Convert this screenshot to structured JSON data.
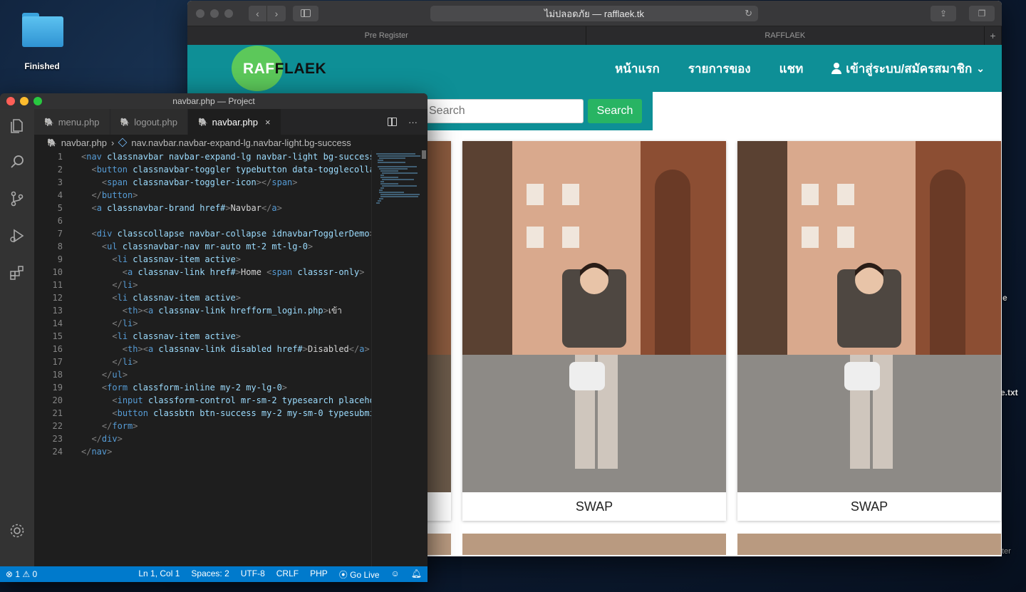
{
  "desktop": {
    "folder_label": "Finished",
    "peek_1": "e",
    "peek_2": "e.txt",
    "peek_3": "ter"
  },
  "browser": {
    "url": "ไม่ปลอดภัย — rafflaek.tk",
    "tabs": [
      "Pre Register",
      "RAFFLAEK"
    ],
    "add_tab": "+"
  },
  "site": {
    "logo_a": "RAF",
    "logo_b": "FLAEK",
    "nav": {
      "home": "หน้าแรก",
      "items": "รายการของ",
      "chat": "แชท",
      "login": "เข้าสู่ระบบ/สมัครสมาชิก"
    },
    "search": {
      "placeholder": "Search",
      "button": "Search"
    },
    "cards": [
      {
        "caption": "SWAP"
      },
      {
        "caption": "SWAP"
      }
    ]
  },
  "vscode": {
    "title": "navbar.php — Project",
    "tabs": [
      "menu.php",
      "logout.php",
      "navbar.php"
    ],
    "breadcrumb": {
      "file": "navbar.php",
      "symbol": "nav.navbar.navbar-expand-lg.navbar-light.bg-success"
    },
    "code_lines": [
      "<nav class=\"navbar navbar-expand-lg navbar-light bg-success\">",
      "  <button class=\"navbar-toggler\" type=\"button\" data-toggle=\"collapse\">",
      "    <span class=\"navbar-toggler-icon\"></span>",
      "  </button>",
      "  <a class=\"navbar-brand\" href=\"#\">Navbar</a>",
      "",
      "  <div class=\"collapse navbar-collapse\" id=\"navbarTogglerDemo\">",
      "    <ul class=\"navbar-nav mr-auto mt-2 mt-lg-0\">",
      "      <li class=\"nav-item active\">",
      "        <a class=\"nav-link\" href=\"#\">Home <span class=\"sr-only\">",
      "      </li>",
      "      <li class=\"nav-item active\">",
      "        <th><a class=\"nav-link\" href=\"form_login.php\">เข้า",
      "      </li>",
      "      <li class=\"nav-item active\">",
      "        <th><a class=\"nav-link disabled\" href=\"#\">Disabled</a>",
      "      </li>",
      "    </ul>",
      "    <form class=\"form-inline my-2 my-lg-0\">",
      "      <input class=\"form-control mr-sm-2\" type=\"search\" placeholder",
      "      <button class=\"btn btn-success my-2 my-sm-0\" type=\"submit\">",
      "    </form>",
      "  </div>",
      "</nav>"
    ],
    "status": {
      "problems": "⊗ 1 ⚠ 0",
      "position": "Ln 1, Col 1",
      "spaces": "Spaces: 2",
      "encoding": "UTF-8",
      "eol": "CRLF",
      "language": "PHP",
      "live": "⦿ Go Live"
    }
  }
}
